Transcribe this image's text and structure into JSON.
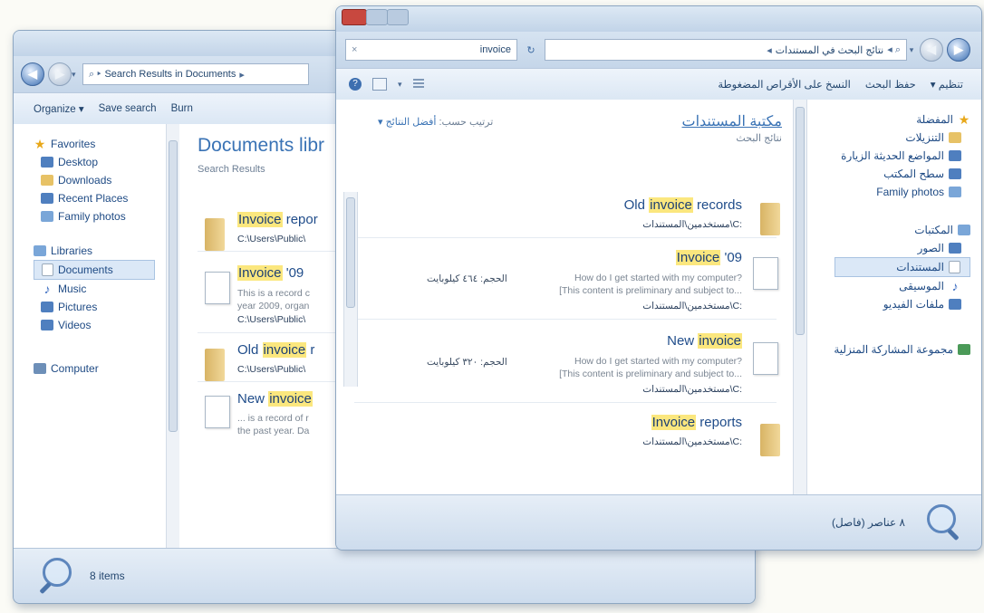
{
  "left_window": {
    "address": "Search Results in Documents",
    "toolbar": {
      "organize": "Organize ▾",
      "save_search": "Save search",
      "burn": "Burn"
    },
    "nav": {
      "favorites": "Favorites",
      "desktop": "Desktop",
      "downloads": "Downloads",
      "recent_places": "Recent Places",
      "family_photos": "Family photos",
      "libraries": "Libraries",
      "documents": "Documents",
      "music": "Music",
      "pictures": "Pictures",
      "videos": "Videos",
      "computer": "Computer"
    },
    "library_title": "Documents libr",
    "library_subtitle": "Search Results",
    "results": [
      {
        "pre": "",
        "hl": "Invoice",
        "post": " repor",
        "path": "C:\\Users\\Public\\"
      },
      {
        "pre": "",
        "hl": "Invoice",
        "post": " '09",
        "snippet1": "This is a record c",
        "snippet2": "year 2009, organ",
        "path": "C:\\Users\\Public\\"
      },
      {
        "pre": "Old ",
        "hl": "invoice",
        "post": " r",
        "path": "C:\\Users\\Public\\"
      },
      {
        "pre": "New ",
        "hl": "invoice",
        "post": "",
        "snippet1": "... is a record of r",
        "snippet2": "the past year. Da"
      }
    ],
    "status": "8 items"
  },
  "right_window": {
    "search_value": "invoice",
    "address": "نتائج البحث في المستندات",
    "toolbar": {
      "organize": "تنظيم ▾",
      "save_search": "حفظ البحث",
      "burn": "النسخ على الأقراص المضغوطة"
    },
    "nav": {
      "favorites": "المفضلة",
      "downloads": "التنزيلات",
      "recent_places": "المواضع الحديثة الزيارة",
      "desktop": "سطح المكتب",
      "family_photos": "Family photos",
      "libraries": "المكتبات",
      "pictures": "الصور",
      "documents": "المستندات",
      "music": "الموسيقى",
      "videos": "ملفات الفيديو",
      "homegroup": "مجموعة المشاركة المنزلية"
    },
    "library_title": "مكتبة المستندات",
    "library_subtitle": "نتائج البحث",
    "arrange_by_label": "ترتيب حسب:",
    "arrange_by_value": "أفضل النتائج ▾",
    "results": [
      {
        "pre": "Old ",
        "hl": "invoice",
        "post": " records",
        "path": "مستخدمين\\المستندات\\C:"
      },
      {
        "pre": "",
        "hl": "Invoice",
        "post": " '09",
        "snippet1": "How do I get started with my computer?",
        "snippet2": "[This content is preliminary and subject to...",
        "path": "مستخدمين\\المستندات\\C:",
        "size": "الحجم: ٤٦٤ كيلوبايت"
      },
      {
        "pre": "New ",
        "hl": "invoice",
        "post": "",
        "snippet1": "How do I get started with my computer?",
        "snippet2": "[This content is preliminary and subject to...",
        "path": "مستخدمين\\المستندات\\C:",
        "size": "الحجم: ٣٢٠ كيلوبايت"
      },
      {
        "pre": "",
        "hl": "Invoice",
        "post": " reports",
        "path": "مستخدمين\\المستندات\\C:"
      }
    ],
    "status": "٨ عناصر (فاصل)"
  },
  "colors": {
    "highlight": "#fbe77e",
    "frame": "#c3d4e6",
    "link": "#1f4c8a"
  }
}
